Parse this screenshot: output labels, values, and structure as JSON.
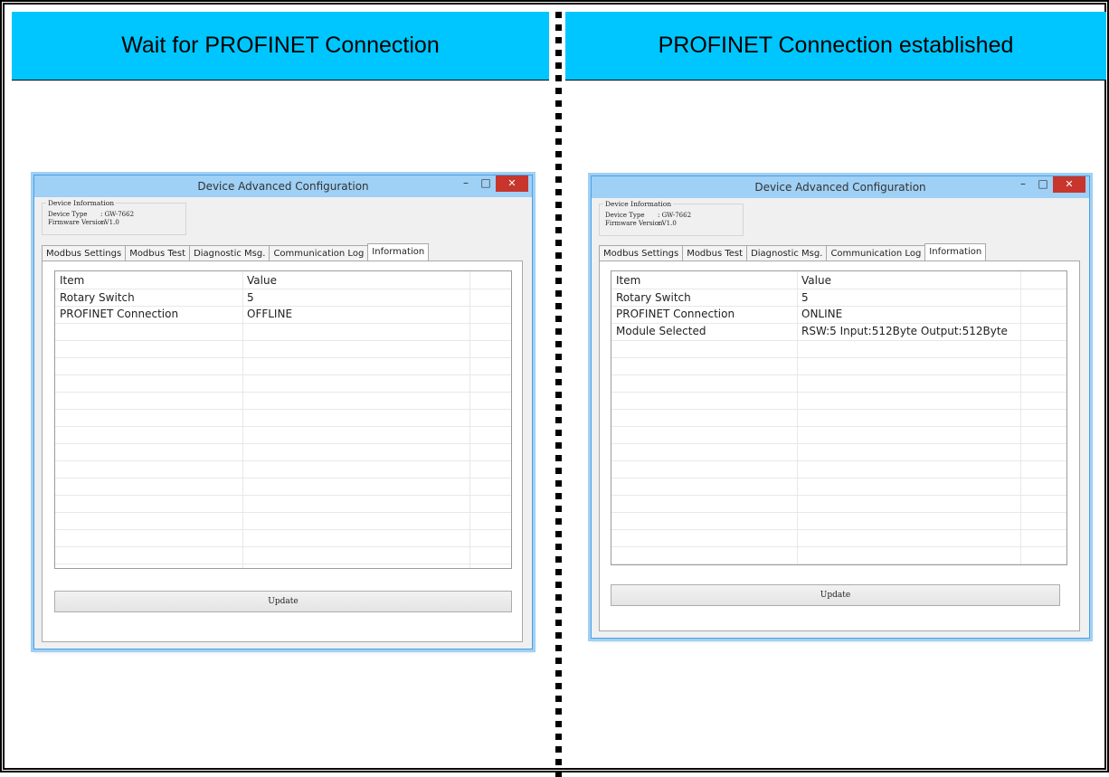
{
  "panels": [
    {
      "banner": "Wait for PROFINET Connection",
      "window": {
        "title": "Device Advanced Configuration",
        "controls": {
          "minimize": "–",
          "maximize": "□",
          "close": "✕"
        },
        "device_info": {
          "legend": "Device Information",
          "device_type_label": "Device Type",
          "device_type_value": ": GW-7662",
          "firmware_label": "Firmware Version",
          "firmware_value": ": V1.0"
        },
        "tabs": [
          "Modbus Settings",
          "Modbus Test",
          "Diagnostic Msg.",
          "Communication Log",
          "Information"
        ],
        "active_tab": "Information",
        "columns": [
          "Item",
          "Value"
        ],
        "rows": [
          [
            "Rotary Switch",
            "5"
          ],
          [
            "PROFINET Connection",
            "OFFLINE"
          ]
        ],
        "update_label": "Update"
      }
    },
    {
      "banner": "PROFINET Connection established",
      "window": {
        "title": "Device Advanced Configuration",
        "controls": {
          "minimize": "–",
          "maximize": "□",
          "close": "✕"
        },
        "device_info": {
          "legend": "Device Information",
          "device_type_label": "Device Type",
          "device_type_value": ": GW-7662",
          "firmware_label": "Firmware Version",
          "firmware_value": ": V1.0"
        },
        "tabs": [
          "Modbus Settings",
          "Modbus Test",
          "Diagnostic Msg.",
          "Communication Log",
          "Information"
        ],
        "active_tab": "Information",
        "columns": [
          "Item",
          "Value"
        ],
        "rows": [
          [
            "Rotary Switch",
            "5"
          ],
          [
            "PROFINET Connection",
            "ONLINE"
          ],
          [
            "Module Selected",
            "RSW:5 Input:512Byte Output:512Byte"
          ]
        ],
        "update_label": "Update"
      }
    }
  ],
  "colors": {
    "banner": "#00c6ff",
    "titlebar": "#9fd0f5",
    "close_button": "#c7352c"
  }
}
